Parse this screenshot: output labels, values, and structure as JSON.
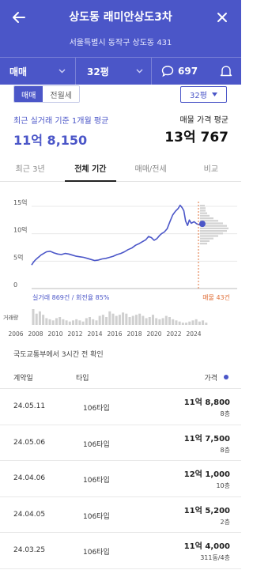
{
  "header": {
    "title": "상도동 래미안상도3차",
    "address": "서울특별시 동작구 상도동 431",
    "trade_type": "매매",
    "size": "32평",
    "comment_count": "697",
    "bg_color": "#4b56c8"
  },
  "filters": {
    "segments": [
      "매매",
      "전월세"
    ],
    "size_select": "32평"
  },
  "summary": {
    "recent_label": "최근 실거래 기준 1개월 평균",
    "recent_value": "11억 8,150",
    "ask_label": "매물 가격 평균",
    "ask_value": "13억 767"
  },
  "tabs": [
    "최근 3년",
    "전체 기간",
    "매매/전세",
    "비교"
  ],
  "chart_data": {
    "type": "line",
    "ylabels": [
      "15억",
      "10억",
      "5억",
      "0"
    ],
    "yticks": [
      15,
      10,
      5,
      0
    ],
    "ylim": [
      0,
      16
    ],
    "xlim": [
      2006,
      2025
    ],
    "xticks": [
      "2006",
      "2008",
      "2010",
      "2012",
      "2014",
      "2016",
      "2018",
      "2020",
      "2022",
      "2024"
    ],
    "series": [
      {
        "x": [
          2006.0,
          2006.2,
          2006.4,
          2006.6,
          2006.8,
          2007.0,
          2007.3,
          2007.6,
          2008.0,
          2008.4,
          2008.8,
          2009.2,
          2009.6,
          2010.0,
          2010.4,
          2010.8,
          2011.2,
          2011.6,
          2012.0,
          2012.4,
          2012.8,
          2013.2,
          2013.6,
          2014.0,
          2014.4,
          2014.8,
          2015.2,
          2015.6,
          2016.0,
          2016.4,
          2016.8,
          2017.2,
          2017.6,
          2018.0,
          2018.3,
          2018.6,
          2018.9,
          2019.2,
          2019.5,
          2019.8,
          2020.0,
          2020.3,
          2020.6,
          2020.9,
          2021.2,
          2021.5,
          2021.8,
          2022.0,
          2022.2,
          2022.4,
          2022.6,
          2022.8,
          2023.0,
          2023.2,
          2023.5,
          2023.8,
          2024.1,
          2024.4
        ],
        "y": [
          4.3,
          4.8,
          5.2,
          5.5,
          5.8,
          6.1,
          6.4,
          6.7,
          6.8,
          6.5,
          6.3,
          6.2,
          6.4,
          6.3,
          6.1,
          5.9,
          5.8,
          5.7,
          5.5,
          5.3,
          5.1,
          5.2,
          5.4,
          5.5,
          5.7,
          5.9,
          6.2,
          6.4,
          6.7,
          7.1,
          7.4,
          7.9,
          8.2,
          8.6,
          8.9,
          9.5,
          9.3,
          8.8,
          9.1,
          9.7,
          10.0,
          10.3,
          10.9,
          12.2,
          13.4,
          14.1,
          14.6,
          15.2,
          14.8,
          14.2,
          12.3,
          11.5,
          12.5,
          11.9,
          12.2,
          11.8,
          11.6,
          11.8
        ]
      }
    ],
    "footer_left": "실거래 869건 / 회전율 85%",
    "footer_right": "매물 43건",
    "volume_label": "거래량",
    "volume": [
      14,
      10,
      12,
      9,
      6,
      5,
      4,
      6,
      7,
      5,
      4,
      3,
      4,
      5,
      4,
      3,
      6,
      7,
      5,
      4,
      8,
      9,
      7,
      12,
      10,
      8,
      9,
      11,
      10,
      7,
      8,
      9,
      10,
      8,
      6,
      7,
      9,
      6,
      5,
      6,
      8,
      7,
      5,
      4,
      3,
      2,
      2,
      3,
      4,
      5,
      3,
      4,
      2
    ],
    "line_color": "#4b56c8"
  },
  "update_note": "국도교통부에서 3시간 전 확인",
  "table": {
    "headers": {
      "date": "계약일",
      "type": "타입",
      "price": "가격"
    },
    "rows": [
      {
        "date": "24.05.11",
        "type": "106타입",
        "price": "11억 8,800",
        "floor": "8층"
      },
      {
        "date": "24.05.06",
        "type": "106타입",
        "price": "11억 7,500",
        "floor": "8층"
      },
      {
        "date": "24.04.06",
        "type": "106타입",
        "price": "12억 1,000",
        "floor": "10층"
      },
      {
        "date": "24.04.05",
        "type": "106타입",
        "price": "11억 5,200",
        "floor": "2층"
      },
      {
        "date": "24.03.25",
        "type": "106타입",
        "price": "11억 4,000",
        "floor": "311동/4층"
      }
    ]
  }
}
